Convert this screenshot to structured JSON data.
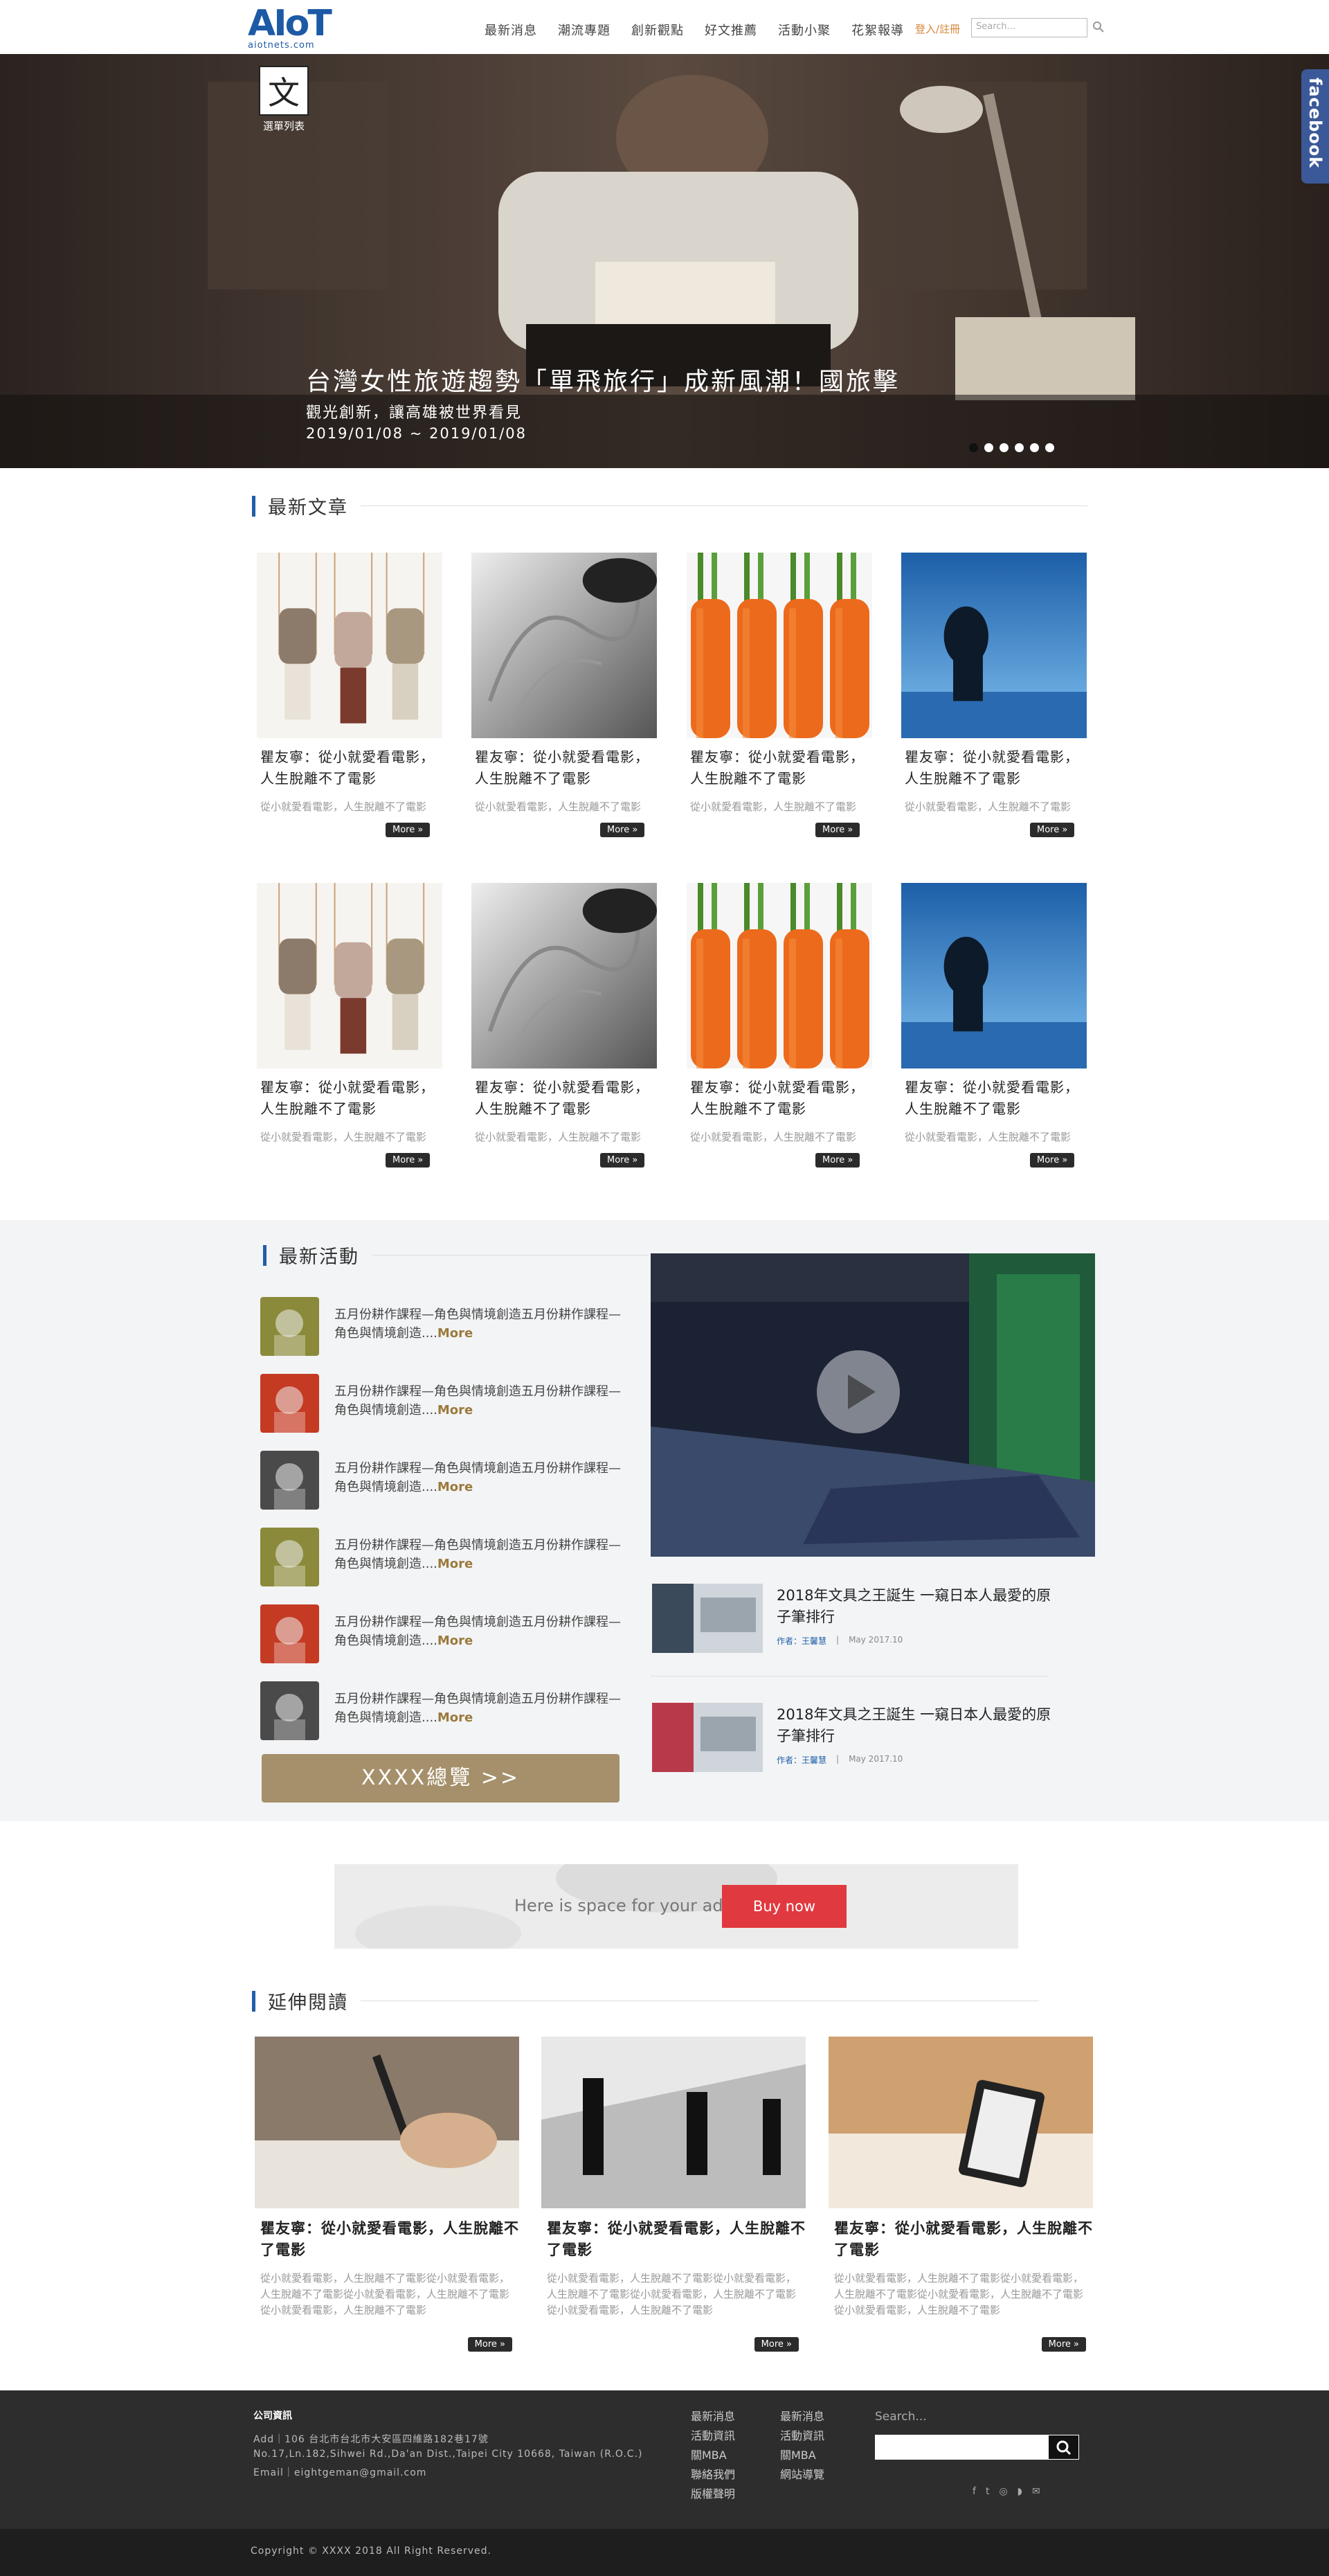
{
  "header": {
    "logo_text": "AIoT",
    "logo_sub": "aiotnets.com",
    "nav": [
      "最新消息",
      "潮流專題",
      "創新觀點",
      "好文推薦",
      "活動小聚",
      "花絮報導"
    ],
    "login": "登入/註冊",
    "search_placeholder": "Search..."
  },
  "hero": {
    "reel_label": "選單列表",
    "reel_glyph": "文",
    "title": "台灣女性旅遊趨勢「單飛旅行」成新風潮！國旅擊",
    "subtitle": "觀光創新，讓高雄被世界看見",
    "date": "2019/01/08 ~ 2019/01/08",
    "dots": [
      false,
      true,
      true,
      true,
      true,
      true
    ],
    "facebook": "facebook"
  },
  "latest": {
    "heading": "最新文章",
    "cards": [
      {
        "title": "瞿友寧：從小就愛看電影，人生脫離不了電影",
        "desc": "從小就愛看電影，人生脫離不了電影",
        "more": "More »",
        "img": "swings"
      },
      {
        "title": "瞿友寧：從小就愛看電影，人生脫離不了電影",
        "desc": "從小就愛看電影，人生脫離不了電影",
        "more": "More »",
        "img": "paper"
      },
      {
        "title": "瞿友寧：從小就愛看電影，人生脫離不了電影",
        "desc": "從小就愛看電影，人生脫離不了電影",
        "more": "More »",
        "img": "carrots"
      },
      {
        "title": "瞿友寧：從小就愛看電影，人生脫離不了電影",
        "desc": "從小就愛看電影，人生脫離不了電影",
        "more": "More »",
        "img": "stage"
      },
      {
        "title": "瞿友寧：從小就愛看電影，人生脫離不了電影",
        "desc": "從小就愛看電影，人生脫離不了電影",
        "more": "More »",
        "img": "swings"
      },
      {
        "title": "瞿友寧：從小就愛看電影，人生脫離不了電影",
        "desc": "從小就愛看電影，人生脫離不了電影",
        "more": "More »",
        "img": "paper"
      },
      {
        "title": "瞿友寧：從小就愛看電影，人生脫離不了電影",
        "desc": "從小就愛看電影，人生脫離不了電影",
        "more": "More »",
        "img": "carrots"
      },
      {
        "title": "瞿友寧：從小就愛看電影，人生脫離不了電影",
        "desc": "從小就愛看電影，人生脫離不了電影",
        "more": "More »",
        "img": "stage"
      }
    ]
  },
  "events": {
    "heading": "最新活動",
    "items": [
      {
        "text": "五月份耕作課程—角色與情境創造五月份耕作課程—角色與情境創造....",
        "more": "More",
        "color": "#8a8a3a"
      },
      {
        "text": "五月份耕作課程—角色與情境創造五月份耕作課程—角色與情境創造....",
        "more": "More",
        "color": "#c43a22"
      },
      {
        "text": "五月份耕作課程—角色與情境創造五月份耕作課程—角色與情境創造....",
        "more": "More",
        "color": "#4a4a4a"
      },
      {
        "text": "五月份耕作課程—角色與情境創造五月份耕作課程—角色與情境創造....",
        "more": "More",
        "color": "#8a8a3a"
      },
      {
        "text": "五月份耕作課程—角色與情境創造五月份耕作課程—角色與情境創造....",
        "more": "More",
        "color": "#c43a22"
      },
      {
        "text": "五月份耕作課程—角色與情境創造五月份耕作課程—角色與情境創造....",
        "more": "More",
        "color": "#4a4a4a"
      }
    ],
    "all_button": "XXXX總覽 >>",
    "news": [
      {
        "title": "2018年文具之王誕生 一窺日本人最愛的原子筆排行",
        "author": "作者：王馨慧",
        "sep": "|",
        "date": "May 2017.10"
      },
      {
        "title": "2018年文具之王誕生 一窺日本人最愛的原子筆排行",
        "author": "作者：王馨慧",
        "sep": "|",
        "date": "May 2017.10"
      }
    ]
  },
  "ad": {
    "text": "Here is space for your ad",
    "button": "Buy now"
  },
  "reading": {
    "heading": "延伸閱讀",
    "cards": [
      {
        "title": "瞿友寧：從小就愛看電影，人生脫離不了電影",
        "desc": "從小就愛看電影，人生脫離不了電影從小就愛看電影，人生脫離不了電影從小就愛看電影，人生脫離不了電影從小就愛看電影，人生脫離不了電影",
        "more": "More »"
      },
      {
        "title": "瞿友寧：從小就愛看電影，人生脫離不了電影",
        "desc": "從小就愛看電影，人生脫離不了電影從小就愛看電影，人生脫離不了電影從小就愛看電影，人生脫離不了電影從小就愛看電影，人生脫離不了電影",
        "more": "More »"
      },
      {
        "title": "瞿友寧：從小就愛看電影，人生脫離不了電影",
        "desc": "從小就愛看電影，人生脫離不了電影從小就愛看電影，人生脫離不了電影從小就愛看電影，人生脫離不了電影從小就愛看電影，人生脫離不了電影",
        "more": "More »"
      }
    ]
  },
  "footer": {
    "heading": "公司資訊",
    "lines": [
      "Add｜106 台北市台北市大安區四維路182巷17號",
      "No.17,Ln.182,Sihwei Rd.,Da'an Dist.,Taipei City 10668, Taiwan (R.O.C.)",
      "Email｜eightgeman@gmail.com"
    ],
    "links_col1": [
      "最新消息",
      "活動資訊",
      "關MBA",
      "聯絡我們",
      "版權聲明"
    ],
    "links_col2": [
      "最新消息",
      "活動資訊",
      "關MBA",
      "網站導覽"
    ],
    "search_label": "Search...",
    "social": [
      "f",
      "t",
      "◎",
      "◗",
      "✉"
    ],
    "copyright": "Copyright © XXXX 2018 All Right Reserved."
  }
}
